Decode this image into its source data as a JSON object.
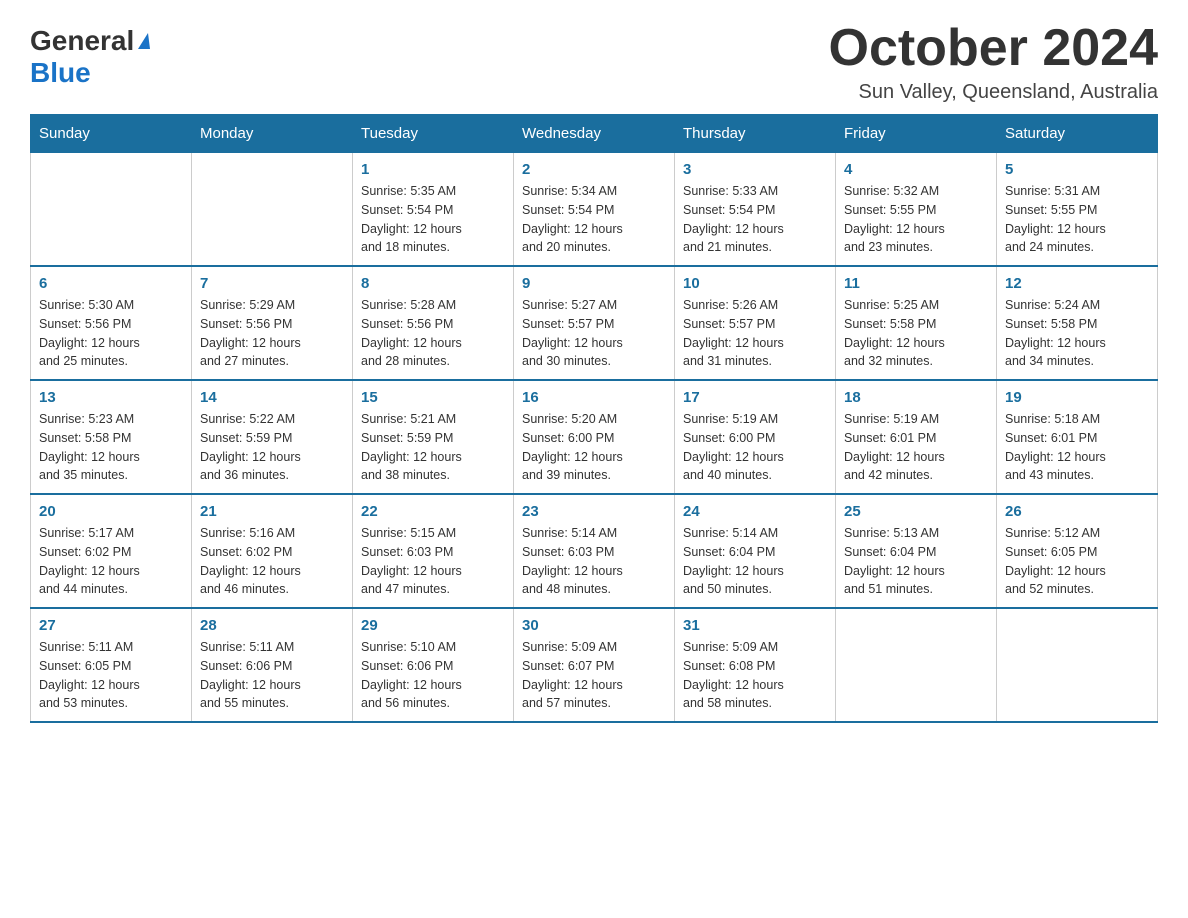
{
  "header": {
    "logo_general": "General",
    "logo_arrow": "▲",
    "logo_blue": "Blue",
    "month_title": "October 2024",
    "location": "Sun Valley, Queensland, Australia"
  },
  "days_of_week": [
    "Sunday",
    "Monday",
    "Tuesday",
    "Wednesday",
    "Thursday",
    "Friday",
    "Saturday"
  ],
  "weeks": [
    {
      "days": [
        {
          "number": "",
          "info": ""
        },
        {
          "number": "",
          "info": ""
        },
        {
          "number": "1",
          "info": "Sunrise: 5:35 AM\nSunset: 5:54 PM\nDaylight: 12 hours\nand 18 minutes."
        },
        {
          "number": "2",
          "info": "Sunrise: 5:34 AM\nSunset: 5:54 PM\nDaylight: 12 hours\nand 20 minutes."
        },
        {
          "number": "3",
          "info": "Sunrise: 5:33 AM\nSunset: 5:54 PM\nDaylight: 12 hours\nand 21 minutes."
        },
        {
          "number": "4",
          "info": "Sunrise: 5:32 AM\nSunset: 5:55 PM\nDaylight: 12 hours\nand 23 minutes."
        },
        {
          "number": "5",
          "info": "Sunrise: 5:31 AM\nSunset: 5:55 PM\nDaylight: 12 hours\nand 24 minutes."
        }
      ]
    },
    {
      "days": [
        {
          "number": "6",
          "info": "Sunrise: 5:30 AM\nSunset: 5:56 PM\nDaylight: 12 hours\nand 25 minutes."
        },
        {
          "number": "7",
          "info": "Sunrise: 5:29 AM\nSunset: 5:56 PM\nDaylight: 12 hours\nand 27 minutes."
        },
        {
          "number": "8",
          "info": "Sunrise: 5:28 AM\nSunset: 5:56 PM\nDaylight: 12 hours\nand 28 minutes."
        },
        {
          "number": "9",
          "info": "Sunrise: 5:27 AM\nSunset: 5:57 PM\nDaylight: 12 hours\nand 30 minutes."
        },
        {
          "number": "10",
          "info": "Sunrise: 5:26 AM\nSunset: 5:57 PM\nDaylight: 12 hours\nand 31 minutes."
        },
        {
          "number": "11",
          "info": "Sunrise: 5:25 AM\nSunset: 5:58 PM\nDaylight: 12 hours\nand 32 minutes."
        },
        {
          "number": "12",
          "info": "Sunrise: 5:24 AM\nSunset: 5:58 PM\nDaylight: 12 hours\nand 34 minutes."
        }
      ]
    },
    {
      "days": [
        {
          "number": "13",
          "info": "Sunrise: 5:23 AM\nSunset: 5:58 PM\nDaylight: 12 hours\nand 35 minutes."
        },
        {
          "number": "14",
          "info": "Sunrise: 5:22 AM\nSunset: 5:59 PM\nDaylight: 12 hours\nand 36 minutes."
        },
        {
          "number": "15",
          "info": "Sunrise: 5:21 AM\nSunset: 5:59 PM\nDaylight: 12 hours\nand 38 minutes."
        },
        {
          "number": "16",
          "info": "Sunrise: 5:20 AM\nSunset: 6:00 PM\nDaylight: 12 hours\nand 39 minutes."
        },
        {
          "number": "17",
          "info": "Sunrise: 5:19 AM\nSunset: 6:00 PM\nDaylight: 12 hours\nand 40 minutes."
        },
        {
          "number": "18",
          "info": "Sunrise: 5:19 AM\nSunset: 6:01 PM\nDaylight: 12 hours\nand 42 minutes."
        },
        {
          "number": "19",
          "info": "Sunrise: 5:18 AM\nSunset: 6:01 PM\nDaylight: 12 hours\nand 43 minutes."
        }
      ]
    },
    {
      "days": [
        {
          "number": "20",
          "info": "Sunrise: 5:17 AM\nSunset: 6:02 PM\nDaylight: 12 hours\nand 44 minutes."
        },
        {
          "number": "21",
          "info": "Sunrise: 5:16 AM\nSunset: 6:02 PM\nDaylight: 12 hours\nand 46 minutes."
        },
        {
          "number": "22",
          "info": "Sunrise: 5:15 AM\nSunset: 6:03 PM\nDaylight: 12 hours\nand 47 minutes."
        },
        {
          "number": "23",
          "info": "Sunrise: 5:14 AM\nSunset: 6:03 PM\nDaylight: 12 hours\nand 48 minutes."
        },
        {
          "number": "24",
          "info": "Sunrise: 5:14 AM\nSunset: 6:04 PM\nDaylight: 12 hours\nand 50 minutes."
        },
        {
          "number": "25",
          "info": "Sunrise: 5:13 AM\nSunset: 6:04 PM\nDaylight: 12 hours\nand 51 minutes."
        },
        {
          "number": "26",
          "info": "Sunrise: 5:12 AM\nSunset: 6:05 PM\nDaylight: 12 hours\nand 52 minutes."
        }
      ]
    },
    {
      "days": [
        {
          "number": "27",
          "info": "Sunrise: 5:11 AM\nSunset: 6:05 PM\nDaylight: 12 hours\nand 53 minutes."
        },
        {
          "number": "28",
          "info": "Sunrise: 5:11 AM\nSunset: 6:06 PM\nDaylight: 12 hours\nand 55 minutes."
        },
        {
          "number": "29",
          "info": "Sunrise: 5:10 AM\nSunset: 6:06 PM\nDaylight: 12 hours\nand 56 minutes."
        },
        {
          "number": "30",
          "info": "Sunrise: 5:09 AM\nSunset: 6:07 PM\nDaylight: 12 hours\nand 57 minutes."
        },
        {
          "number": "31",
          "info": "Sunrise: 5:09 AM\nSunset: 6:08 PM\nDaylight: 12 hours\nand 58 minutes."
        },
        {
          "number": "",
          "info": ""
        },
        {
          "number": "",
          "info": ""
        }
      ]
    }
  ]
}
